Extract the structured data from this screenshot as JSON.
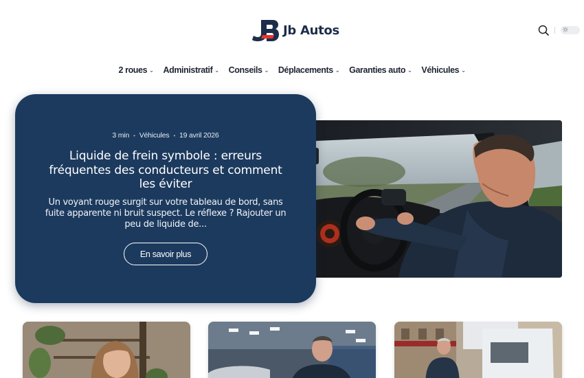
{
  "brand": {
    "name": "Jb Autos",
    "accent": "#e8342e",
    "navy": "#1d2e4a"
  },
  "header": {
    "search_icon": "search-icon",
    "theme_icon": "sun-icon"
  },
  "nav": {
    "items": [
      {
        "label": "2 roues"
      },
      {
        "label": "Administratif"
      },
      {
        "label": "Conseils"
      },
      {
        "label": "Déplacements"
      },
      {
        "label": "Garanties auto"
      },
      {
        "label": "Véhicules"
      }
    ],
    "chevron": "⌄"
  },
  "hero": {
    "read_time": "3 min",
    "category": "Véhicules",
    "date": "19 avril 2026",
    "title": "Liquide de frein symbole : erreurs fréquentes des conducteurs et comment les éviter",
    "excerpt": "Un voyant rouge surgit sur votre tableau de bord, sans fuite apparente ni bruit suspect. Le réflexe ? Rajouter un peu de liquide de...",
    "button_label": "En savoir plus",
    "image": "man-driving-car-photo",
    "card_color": "#1c3a5e"
  },
  "cards": [
    {
      "image": "woman-thinking-photo"
    },
    {
      "image": "mechanic-garage-photo"
    },
    {
      "image": "man-with-van-street-photo"
    }
  ]
}
